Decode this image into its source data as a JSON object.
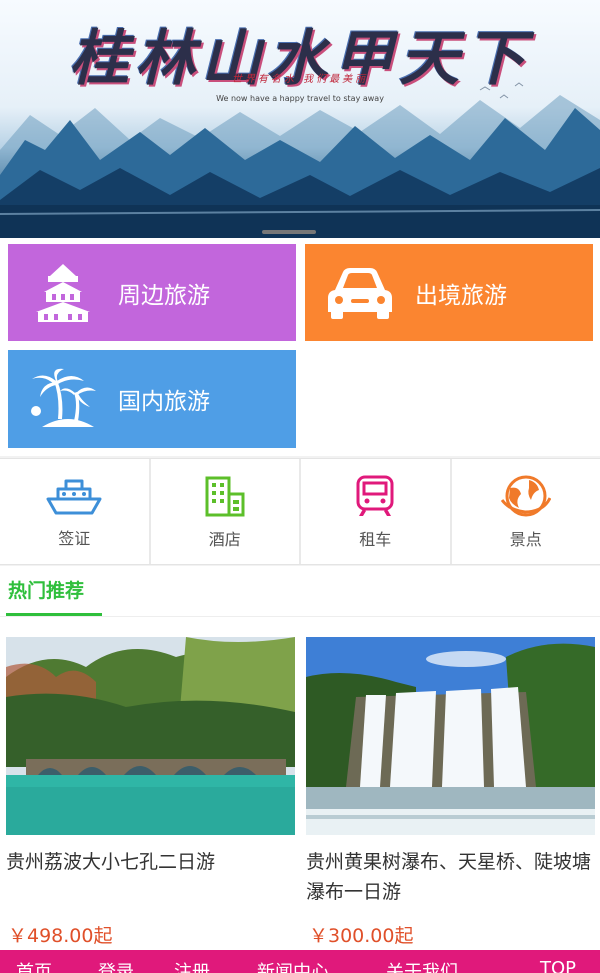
{
  "banner": {
    "title": "桂林山水甲天下",
    "subtitle_cn": "世界有名水 我们最美丽",
    "subtitle_en": "We now have a happy travel to stay away"
  },
  "categories": [
    {
      "label": "周边旅游",
      "icon": "temple-icon",
      "color": "#c266dc"
    },
    {
      "label": "出境旅游",
      "icon": "car-icon",
      "color": "#fb8530"
    },
    {
      "label": "国内旅游",
      "icon": "palm-island-icon",
      "color": "#4f9ee6"
    }
  ],
  "quick_links": [
    {
      "label": "签证",
      "icon": "ship-icon",
      "color": "#3d8fd8"
    },
    {
      "label": "酒店",
      "icon": "building-icon",
      "color": "#5cbf2a"
    },
    {
      "label": "租车",
      "icon": "train-icon",
      "color": "#e0197b"
    },
    {
      "label": "景点",
      "icon": "globe-icon",
      "color": "#f07a2a"
    }
  ],
  "hot": {
    "heading": "热门推荐",
    "items": [
      {
        "name": "贵州荔波大小七孔二日游",
        "price": "￥498.00起"
      },
      {
        "name": "贵州黄果树瀑布、天星桥、陡坡塘瀑布一日游",
        "price": "￥300.00起"
      }
    ]
  },
  "footer": {
    "items": [
      "首页",
      "登录",
      "注册",
      "新闻中心",
      "关于我们",
      "TOP"
    ]
  }
}
